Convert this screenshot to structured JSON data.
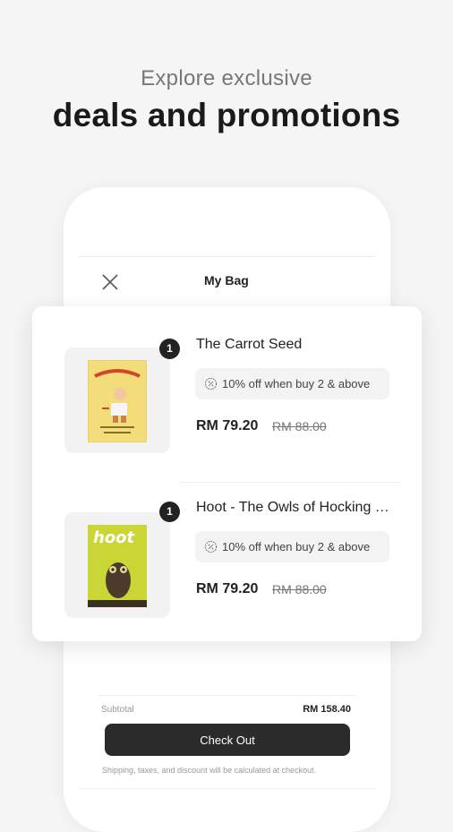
{
  "headline": {
    "subtitle": "Explore exclusive",
    "title": "deals and promotions"
  },
  "bag": {
    "title": "My Bag",
    "items": [
      {
        "qty": "1",
        "title": "The Carrot Seed",
        "cover_text": "THE CARROT SEED",
        "promo": "10% off when buy 2 & above",
        "price": "RM 79.20",
        "old_price": "RM 88.00"
      },
      {
        "qty": "1",
        "title": "Hoot - The Owls of Hocking Hills",
        "cover_text": "hoot",
        "promo": "10% off when buy 2 & above",
        "price": "RM 79.20",
        "old_price": "RM 88.00"
      }
    ],
    "subtotal_label": "Subtotal",
    "subtotal_value": "RM 158.40",
    "checkout_label": "Check Out",
    "note": "Shipping, taxes, and discount will be calculated at checkout."
  },
  "colors": {
    "background": "#f5f5f5",
    "badge": "#222222",
    "checkout_button": "#2b2b2b",
    "carrot_cover": "#f2dd7a",
    "hoot_cover": "#c9d636"
  }
}
